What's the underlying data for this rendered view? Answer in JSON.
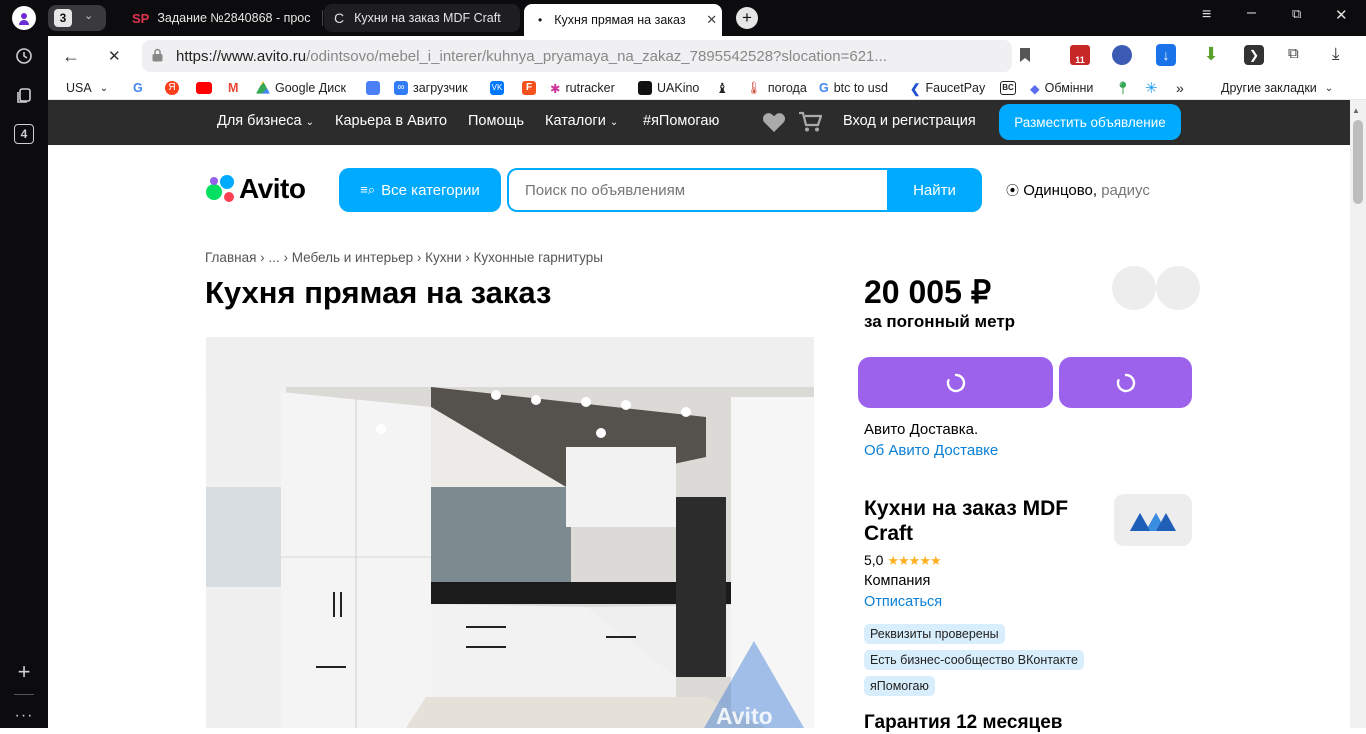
{
  "browser": {
    "tab_count": "3",
    "tabs": [
      {
        "label": "Задание №2840868 - прос",
        "favicon": "SP"
      },
      {
        "label": "Кухни на заказ MDF Craft"
      },
      {
        "label": "Кухня прямая на заказ"
      }
    ],
    "url_prefix": "https://www.avito.ru",
    "url_path": "/odintsovo/mebel_i_interer/kuhnya_pryamaya_na_zakaz_7895542528?slocation=621...",
    "sidebar_badge": "4",
    "ext_badge": "11",
    "bookmarks": [
      {
        "label": "USA",
        "color": "#ffffff"
      },
      {
        "label": "",
        "color": "#4285f4"
      },
      {
        "label": "",
        "color": "#fc3f1d"
      },
      {
        "label": "",
        "color": "#ff0000"
      },
      {
        "label": "",
        "color": "#ea4335"
      },
      {
        "label": "Google Диск",
        "color": "#34a853"
      },
      {
        "label": "",
        "color": "#4a7ff5"
      },
      {
        "label": "загрузчик",
        "color": "#2f7cf6"
      },
      {
        "label": "",
        "color": "#0077ff"
      },
      {
        "label": "",
        "color": "#f4511e"
      },
      {
        "label": "rutracker",
        "color": "#cc3399"
      },
      {
        "label": "UAKino",
        "color": "#111111"
      },
      {
        "label": "",
        "color": "#444444"
      },
      {
        "label": "погода",
        "color": "#d24a3a"
      },
      {
        "label": "btc to usd",
        "color": "#4285f4"
      },
      {
        "label": "FaucetPay",
        "color": "#2050d0"
      },
      {
        "label": "",
        "color": "#222222"
      },
      {
        "label": "Обмінни",
        "color": "#5a6cf0"
      },
      {
        "label": "",
        "color": "#34a853"
      },
      {
        "label": "",
        "color": "#1a9cf0"
      }
    ],
    "bookmarks_more": "»",
    "other_bookmarks": "Другие закладки"
  },
  "topnav": {
    "business": "Для бизнеса",
    "career": "Карьера в Авито",
    "help": "Помощь",
    "catalogs": "Каталоги",
    "ihelp": "#яПомогаю",
    "login": "Вход и регистрация",
    "post": "Разместить объявление"
  },
  "header": {
    "logo": "Avito",
    "categories": "Все категории",
    "search_placeholder": "Поиск по объявлениям",
    "search_button": "Найти",
    "location": "Одинцово,",
    "radius": "радиус"
  },
  "breadcrumbs": [
    "Главная",
    "...",
    "Мебель и интерьер",
    "Кухни",
    "Кухонные гарнитуры"
  ],
  "listing": {
    "title": "Кухня прямая на заказ",
    "price": "20 005 ₽",
    "price_unit": "за погонный метр",
    "delivery": "Авито Доставка.",
    "delivery_link": "Об Авито Доставке",
    "watermark": "Avito"
  },
  "seller": {
    "name": "Кухни на заказ MDF Craft",
    "rating": "5,0",
    "stars": "★★★★★",
    "type": "Компания",
    "unsubscribe": "Отписаться",
    "badges": [
      "Реквизиты проверены",
      "Есть бизнес-сообщество ВКонтакте",
      "яПомогаю"
    ],
    "guarantee": "Гарантия 12 месяцев"
  },
  "colors": {
    "avito_blue": "#00aaff",
    "purple": "#9d62ec",
    "link": "#0a80d8",
    "star": "#ffb021"
  }
}
